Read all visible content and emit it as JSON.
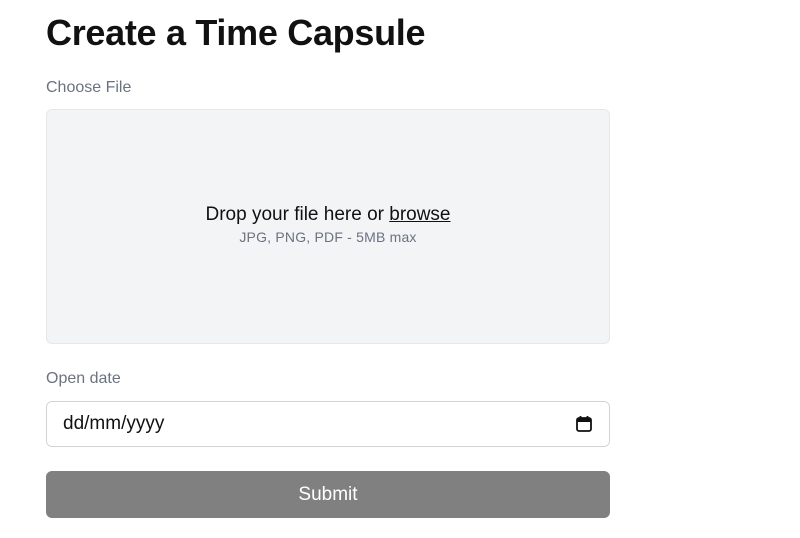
{
  "page": {
    "title": "Create a Time Capsule"
  },
  "file_upload": {
    "label": "Choose File",
    "drop_text": "Drop your file here or",
    "browse_text": "browse",
    "hint": "JPG, PNG, PDF - 5MB max"
  },
  "open_date": {
    "label": "Open date",
    "placeholder": "dd/mm/yyyy",
    "icon": "calendar-icon"
  },
  "submit": {
    "label": "Submit",
    "background_color": "#808080"
  }
}
